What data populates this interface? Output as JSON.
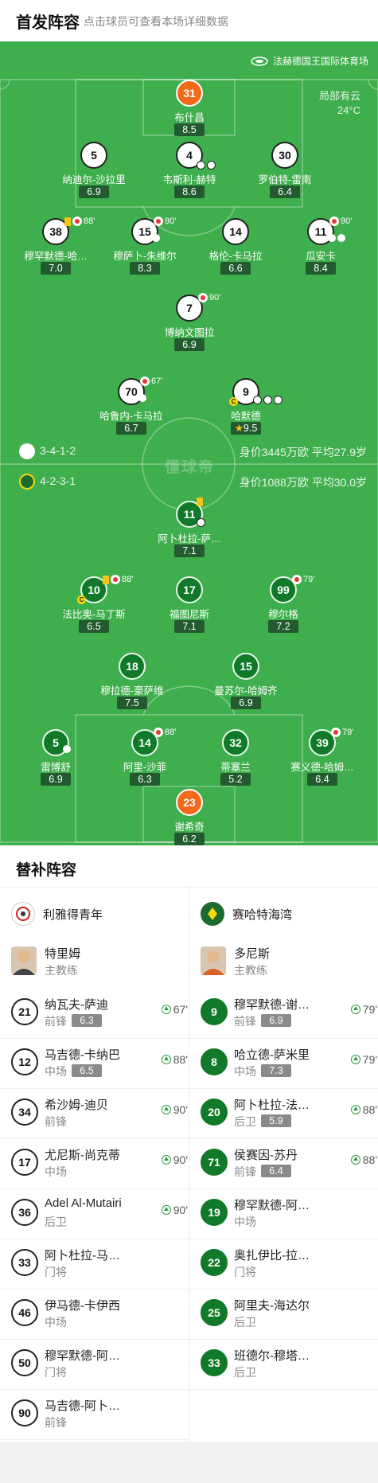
{
  "header": {
    "title": "首发阵容",
    "hint": "点击球员可查看本场详细数据"
  },
  "venue": "法赫德国王国际体育场",
  "weather": {
    "desc": "局部有云",
    "temp": "24°C"
  },
  "watermark": "懂球帝",
  "home": {
    "formation": "3-4-1-2",
    "value_info": "身价3445万欧 平均27.9岁",
    "players": [
      {
        "num": "31",
        "name": "布什昌",
        "rating": "8.5"
      },
      {
        "num": "5",
        "name": "纳迪尔-沙拉里",
        "rating": "6.9"
      },
      {
        "num": "4",
        "name": "韦斯利-赫特",
        "rating": "8.6"
      },
      {
        "num": "30",
        "name": "罗伯特-雷南",
        "rating": "6.4"
      },
      {
        "num": "38",
        "name": "穆罕默德-哈…",
        "rating": "7.0",
        "sub": "88'"
      },
      {
        "num": "15",
        "name": "穆萨卜-朱维尔",
        "rating": "8.3",
        "sub": "90'"
      },
      {
        "num": "14",
        "name": "格伦-卡马拉",
        "rating": "6.6"
      },
      {
        "num": "11",
        "name": "瓜安卡",
        "rating": "8.4",
        "sub": "90'"
      },
      {
        "num": "7",
        "name": "博纳文图拉",
        "rating": "6.9",
        "sub": "90'"
      },
      {
        "num": "70",
        "name": "哈鲁内-卡马拉",
        "rating": "6.7",
        "sub": "67'"
      },
      {
        "num": "9",
        "name": "哈默德",
        "rating": "9.5"
      }
    ]
  },
  "away": {
    "formation": "4-2-3-1",
    "value_info": "身价1088万欧 平均30.0岁",
    "players": [
      {
        "num": "11",
        "name": "阿卜杜拉-萨…",
        "rating": "7.1"
      },
      {
        "num": "10",
        "name": "法比奥-马丁斯",
        "rating": "6.5",
        "sub": "88'"
      },
      {
        "num": "17",
        "name": "福图尼斯",
        "rating": "7.1"
      },
      {
        "num": "99",
        "name": "穆尔格",
        "rating": "7.2",
        "sub": "79'"
      },
      {
        "num": "18",
        "name": "穆拉德-豪萨维",
        "rating": "7.5"
      },
      {
        "num": "15",
        "name": "曼苏尔-哈姆齐",
        "rating": "6.9"
      },
      {
        "num": "5",
        "name": "雷博舒",
        "rating": "6.9"
      },
      {
        "num": "14",
        "name": "阿里-沙菲",
        "rating": "6.3",
        "sub": "88'"
      },
      {
        "num": "32",
        "name": "蒂塞兰",
        "rating": "5.2"
      },
      {
        "num": "39",
        "name": "赛义德-哈姆…",
        "rating": "6.4",
        "sub": "79'"
      },
      {
        "num": "23",
        "name": "谢希奇",
        "rating": "6.2"
      }
    ]
  },
  "subs": {
    "title": "替补阵容",
    "home_team": "利雅得青年",
    "away_team": "赛哈特海湾",
    "home_coach": {
      "name": "特里姆",
      "role": "主教练"
    },
    "away_coach": {
      "name": "多尼斯",
      "role": "主教练"
    },
    "home": [
      {
        "num": "21",
        "name": "纳瓦夫-萨迪",
        "pos": "前锋",
        "rating": "6.3",
        "time": "67'"
      },
      {
        "num": "12",
        "name": "马吉德-卡纳巴",
        "pos": "中场",
        "rating": "6.5",
        "time": "88'"
      },
      {
        "num": "34",
        "name": "希沙姆-迪贝",
        "pos": "前锋",
        "rating": "",
        "time": "90'"
      },
      {
        "num": "17",
        "name": "尤尼斯-尚克蒂",
        "pos": "中场",
        "rating": "",
        "time": "90'"
      },
      {
        "num": "36",
        "name": "Adel Al-Mutairi",
        "pos": "后卫",
        "rating": "",
        "time": "90'"
      },
      {
        "num": "33",
        "name": "阿卜杜拉-马…",
        "pos": "门将",
        "rating": "",
        "time": ""
      },
      {
        "num": "46",
        "name": "伊马德-卡伊西",
        "pos": "中场",
        "rating": "",
        "time": ""
      },
      {
        "num": "50",
        "name": "穆罕默德-阿…",
        "pos": "门将",
        "rating": "",
        "time": ""
      },
      {
        "num": "90",
        "name": "马吉德-阿卜…",
        "pos": "前锋",
        "rating": "",
        "time": ""
      }
    ],
    "away": [
      {
        "num": "9",
        "name": "穆罕默德-谢…",
        "pos": "前锋",
        "rating": "6.9",
        "time": "79'"
      },
      {
        "num": "8",
        "name": "哈立德-萨米里",
        "pos": "中场",
        "rating": "7.3",
        "time": "79'"
      },
      {
        "num": "20",
        "name": "阿卜杜拉-法…",
        "pos": "后卫",
        "rating": "5.9",
        "time": "88'"
      },
      {
        "num": "71",
        "name": "侯赛因-苏丹",
        "pos": "前锋",
        "rating": "6.4",
        "time": "88'"
      },
      {
        "num": "19",
        "name": "穆罕默德-阿…",
        "pos": "中场",
        "rating": "",
        "time": ""
      },
      {
        "num": "22",
        "name": "奥扎伊比-拉…",
        "pos": "门将",
        "rating": "",
        "time": ""
      },
      {
        "num": "25",
        "name": "阿里夫-海达尔",
        "pos": "后卫",
        "rating": "",
        "time": ""
      },
      {
        "num": "33",
        "name": "班德尔-穆塔…",
        "pos": "后卫",
        "rating": "",
        "time": ""
      }
    ]
  }
}
